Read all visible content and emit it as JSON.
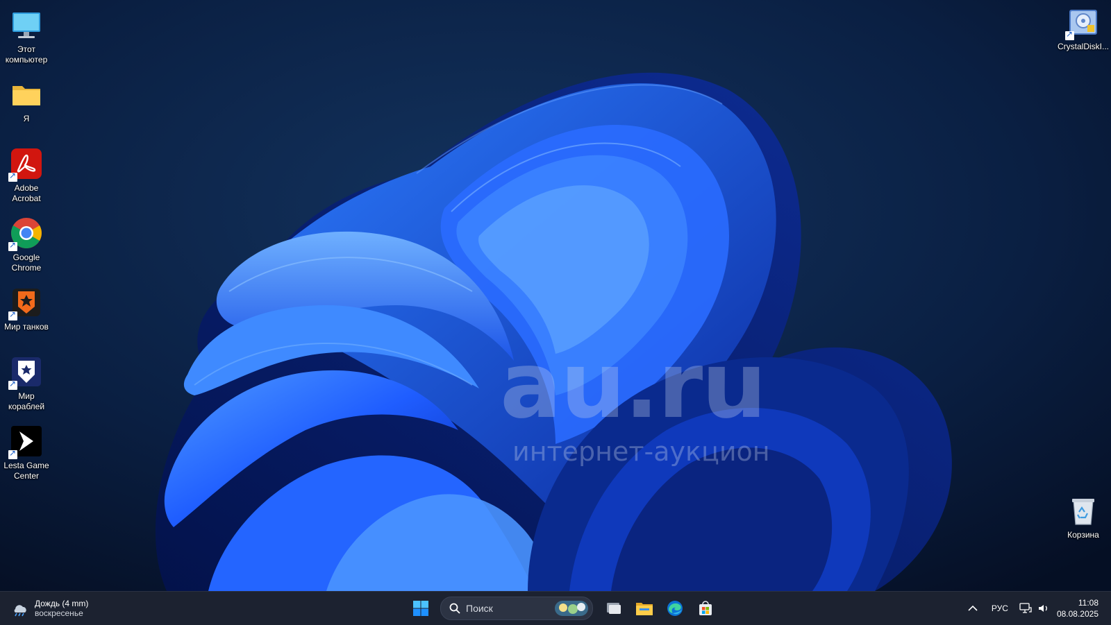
{
  "desktop": {
    "left_icons": [
      {
        "label": "Этот компьютер",
        "icon": "monitor-icon"
      },
      {
        "label": "Я",
        "icon": "folder-icon"
      },
      {
        "label": "Adobe Acrobat",
        "icon": "acrobat-icon"
      },
      {
        "label": "Google Chrome",
        "icon": "chrome-icon"
      },
      {
        "label": "Мир танков",
        "icon": "tanks-game-icon"
      },
      {
        "label": "Мир кораблей",
        "icon": "ships-game-icon"
      },
      {
        "label": "Lesta Game Center",
        "icon": "lesta-icon"
      }
    ],
    "right_icons": [
      {
        "label": "CrystalDiskI...",
        "icon": "crystaldisk-icon"
      },
      {
        "label": "Корзина",
        "icon": "recycle-bin-icon"
      }
    ]
  },
  "watermark": {
    "main": "au.ru",
    "sub": "интернет-аукцион"
  },
  "taskbar": {
    "weather": {
      "title": "Дождь (4 mm)",
      "subtitle": "воскресенье",
      "icon": "rain-cloud-icon"
    },
    "search": {
      "placeholder": "Поиск"
    },
    "pinned": [
      "start-icon",
      "task-view-icon",
      "file-explorer-icon",
      "edge-icon",
      "store-icon"
    ],
    "tray": {
      "language": "РУС",
      "time": "11:08",
      "date": "08.08.2025"
    }
  },
  "colors": {
    "taskbar_bg": "#1c2230",
    "desktop_bg": "#06142e",
    "bloom_blue": "#1e5cff"
  }
}
